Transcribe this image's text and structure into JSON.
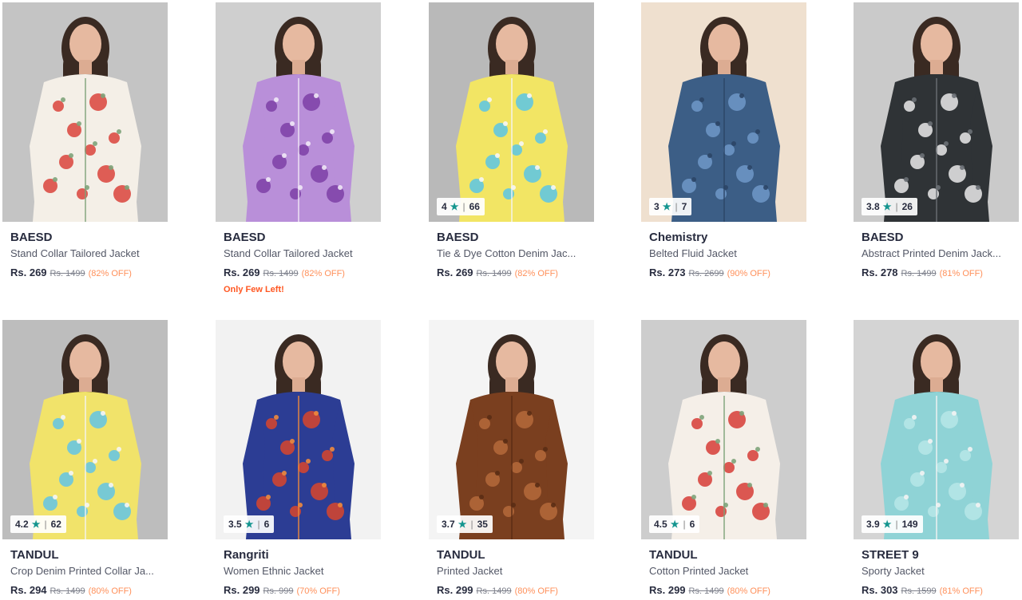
{
  "products": [
    {
      "brand": "BAESD",
      "name": "Stand Collar Tailored Jacket",
      "price": "Rs. 269",
      "mrp": "Rs. 1499",
      "off": "(82% OFF)",
      "rating": null,
      "count": null,
      "tag": null,
      "bg": "#c4c4c4",
      "jacket": "#f4efe7",
      "pattern": "#d9433b",
      "accent": "#7ea37a"
    },
    {
      "brand": "BAESD",
      "name": "Stand Collar Tailored Jacket",
      "price": "Rs. 269",
      "mrp": "Rs. 1499",
      "off": "(82% OFF)",
      "rating": null,
      "count": null,
      "tag": "Only Few Left!",
      "bg": "#cfcfcf",
      "jacket": "#b98fd9",
      "pattern": "#7c3fa6",
      "accent": "#f1e9f6"
    },
    {
      "brand": "BAESD",
      "name": "Tie & Dye Cotton Denim Jac...",
      "price": "Rs. 269",
      "mrp": "Rs. 1499",
      "off": "(82% OFF)",
      "rating": "4",
      "count": "66",
      "tag": null,
      "bg": "#b9b9b9",
      "jacket": "#f2e564",
      "pattern": "#5bc6e6",
      "accent": "#f6f6f6"
    },
    {
      "brand": "Chemistry",
      "name": "Belted Fluid Jacket",
      "price": "Rs. 273",
      "mrp": "Rs. 2699",
      "off": "(90% OFF)",
      "rating": "3",
      "count": "7",
      "tag": null,
      "bg": "#efe0cf",
      "jacket": "#3c5e86",
      "pattern": "#6f98c8",
      "accent": "#2b4566"
    },
    {
      "brand": "BAESD",
      "name": "Abstract Printed Denim Jack...",
      "price": "Rs. 278",
      "mrp": "Rs. 1499",
      "off": "(81% OFF)",
      "rating": "3.8",
      "count": "26",
      "tag": null,
      "bg": "#cacaca",
      "jacket": "#2f3336",
      "pattern": "#eaeaea",
      "accent": "#6b7075"
    },
    {
      "brand": "TANDUL",
      "name": "Crop Denim Printed Collar Ja...",
      "price": "Rs. 294",
      "mrp": "Rs. 1499",
      "off": "(80% OFF)",
      "rating": "4.2",
      "count": "62",
      "tag": null,
      "bg": "#bdbdbd",
      "jacket": "#f1e36a",
      "pattern": "#62c4e6",
      "accent": "#f5f5f5"
    },
    {
      "brand": "Rangriti",
      "name": "Women Ethnic Jacket",
      "price": "Rs. 299",
      "mrp": "Rs. 999",
      "off": "(70% OFF)",
      "rating": "3.5",
      "count": "6",
      "tag": null,
      "bg": "#f2f2f2",
      "jacket": "#2c3d94",
      "pattern": "#d9452c",
      "accent": "#f08a3c"
    },
    {
      "brand": "TANDUL",
      "name": "Printed Jacket",
      "price": "Rs. 299",
      "mrp": "Rs. 1499",
      "off": "(80% OFF)",
      "rating": "3.7",
      "count": "35",
      "tag": null,
      "bg": "#f4f4f4",
      "jacket": "#7a3f1f",
      "pattern": "#b56a3b",
      "accent": "#5a2c14"
    },
    {
      "brand": "TANDUL",
      "name": "Cotton Printed Jacket",
      "price": "Rs. 299",
      "mrp": "Rs. 1499",
      "off": "(80% OFF)",
      "rating": "4.5",
      "count": "6",
      "tag": null,
      "bg": "#cdcdcd",
      "jacket": "#f5efe8",
      "pattern": "#d63c36",
      "accent": "#7ea37a"
    },
    {
      "brand": "STREET 9",
      "name": "Sporty Jacket",
      "price": "Rs. 303",
      "mrp": "Rs. 1599",
      "off": "(81% OFF)",
      "rating": "3.9",
      "count": "149",
      "tag": null,
      "bg": "#d4d4d4",
      "jacket": "#8fd3d6",
      "pattern": "#b7e6e7",
      "accent": "#f3f3f3"
    }
  ]
}
